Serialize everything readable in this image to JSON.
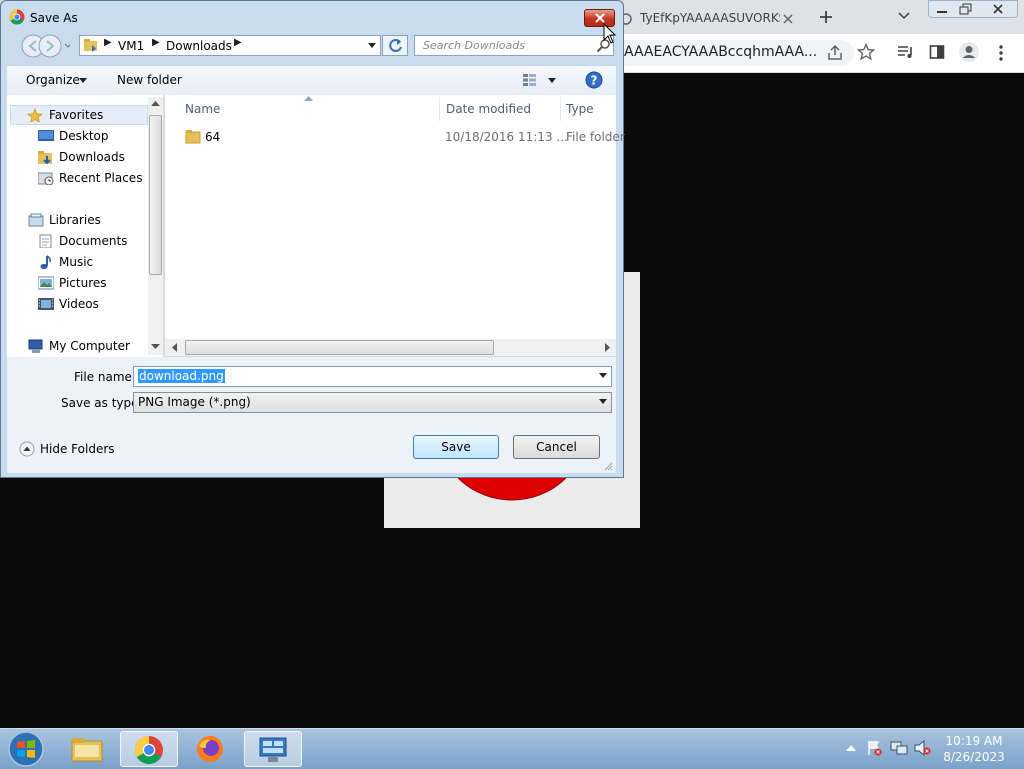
{
  "browser": {
    "tab_title": "TyEfKpYAAAAASUVORKS",
    "url": "AAAEACYAAABccqhmAAA..."
  },
  "dialog": {
    "title": "Save As",
    "breadcrumb": [
      "VM1",
      "Downloads"
    ],
    "search_placeholder": "Search Downloads",
    "toolbar": {
      "organize": "Organize",
      "new_folder": "New folder"
    },
    "nav": {
      "favorites": "Favorites",
      "favorites_items": [
        "Desktop",
        "Downloads",
        "Recent Places"
      ],
      "libraries": "Libraries",
      "libraries_items": [
        "Documents",
        "Music",
        "Pictures",
        "Videos"
      ],
      "computer": "My Computer"
    },
    "columns": {
      "name": "Name",
      "date": "Date modified",
      "type": "Type"
    },
    "files": [
      {
        "name": "64",
        "date": "10/18/2016 11:13 ...",
        "type": "File folder"
      }
    ],
    "file_name_label": "File name:",
    "file_name_value": "download.png",
    "save_type_label": "Save as type:",
    "save_type_value": "PNG Image (*.png)",
    "hide_folders": "Hide Folders",
    "save_button": "Save",
    "cancel_button": "Cancel"
  },
  "taskbar": {
    "time": "10:19 AM",
    "date": "8/26/2023"
  },
  "colors": {
    "dialog_frame": "#c9dcee",
    "selection": "#3399ff",
    "close_red": "#c43622",
    "taskbar": "#7aa1c9"
  }
}
